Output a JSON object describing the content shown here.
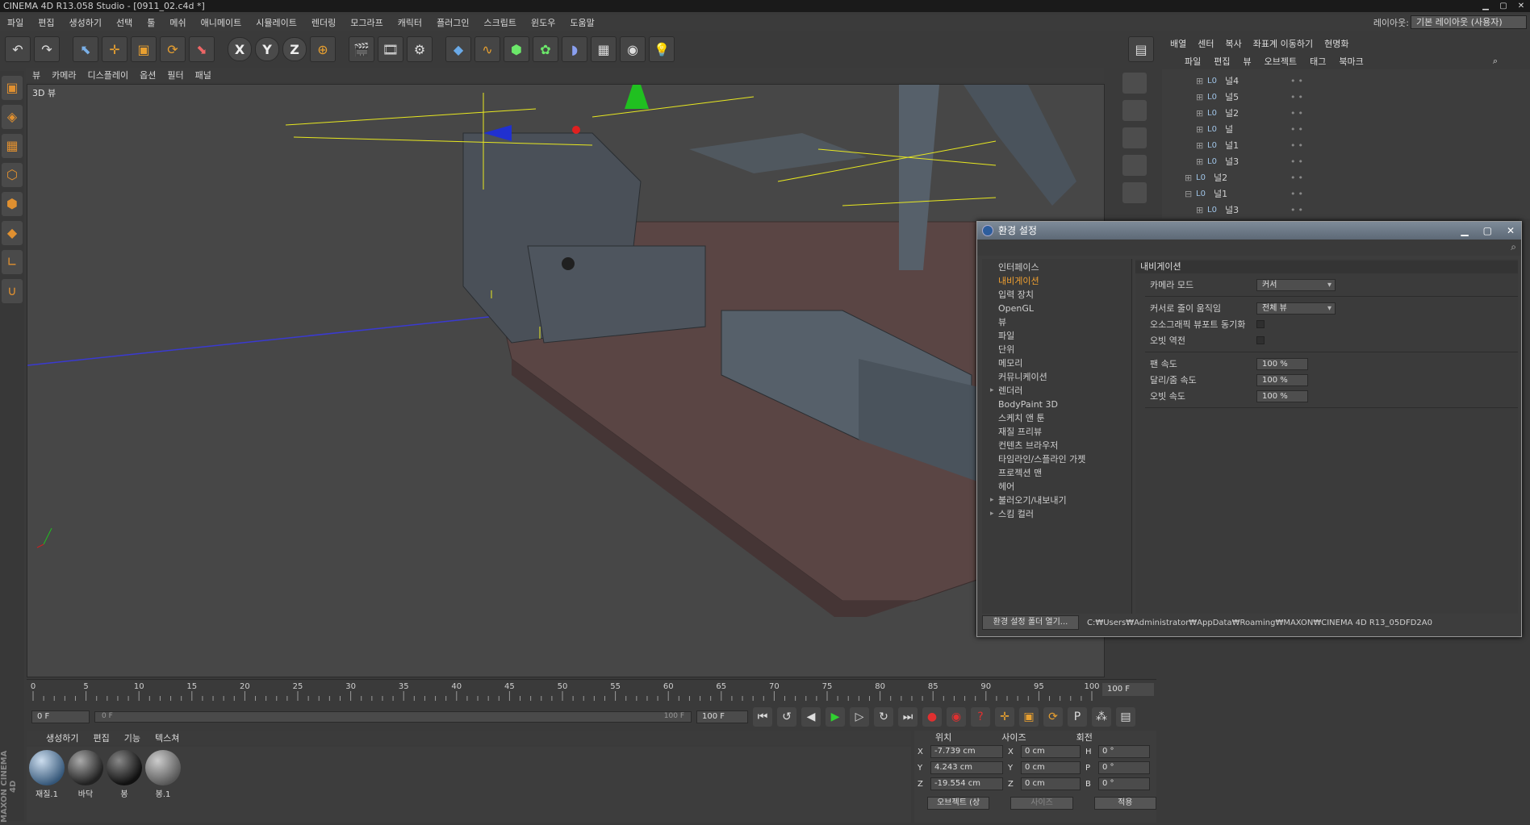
{
  "window": {
    "title": "CINEMA 4D R13.058 Studio - [0911_02.c4d *]"
  },
  "menubar": {
    "items": [
      "파일",
      "편집",
      "생성하기",
      "선택",
      "툴",
      "메쉬",
      "애니메이트",
      "시뮬레이트",
      "렌더링",
      "모그라프",
      "캐릭터",
      "플러그인",
      "스크립트",
      "윈도우",
      "도움말"
    ]
  },
  "layout": {
    "label": "레이아웃:",
    "value": "기본 레이아웃 (사용자)"
  },
  "right_toolbar": {
    "items": [
      "배열",
      "센터",
      "복사",
      "좌표계 이동하기",
      "현명화"
    ]
  },
  "viewport_menu": {
    "items": [
      "뷰",
      "카메라",
      "디스플레이",
      "옵션",
      "필터",
      "패널"
    ]
  },
  "viewport": {
    "label": "3D 뷰"
  },
  "object_manager": {
    "menu": [
      "파일",
      "편집",
      "뷰",
      "오브젝트",
      "태그",
      "북마크"
    ],
    "rows": [
      "널4",
      "널5",
      "널2",
      "널",
      "널1",
      "널3",
      "널2",
      "널1",
      "널3"
    ]
  },
  "dialog": {
    "title": "환경 설정",
    "categories": [
      "인터페이스",
      "내비게이션",
      "입력 장치",
      "OpenGL",
      "뷰",
      "파일",
      "단위",
      "메모리",
      "커뮤니케이션",
      "렌더러",
      "BodyPaint 3D",
      "스케치 앤 툰",
      "재질 프리뷰",
      "컨텐츠 브라우저",
      "타임라인/스플라인 가젯",
      "프로젝션 맨",
      "헤어",
      "불러오기/내보내기",
      "스킴 컬러"
    ],
    "active_category": "내비게이션",
    "pane_title": "내비게이션",
    "props": {
      "camera_mode": {
        "label": "카메라 모드",
        "value": "커서"
      },
      "cursor_pos": {
        "label": "커서로 줄이 움직임",
        "value": "전체 뷰"
      },
      "ortho_sync": {
        "label": "오소그래픽 뷰포트 동기화"
      },
      "orbit_reverse": {
        "label": "오빗 역전"
      },
      "pan_speed": {
        "label": "팬 속도",
        "value": "100 %"
      },
      "dolly_speed": {
        "label": "달리/줌 속도",
        "value": "100 %"
      },
      "orbit_speed": {
        "label": "오빗 속도",
        "value": "100 %"
      }
    },
    "foot_button": "환경 설정 폴더 열기...",
    "foot_path": "C:₩Users₩Administrator₩AppData₩Roaming₩MAXON₩CINEMA 4D R13_05DFD2A0"
  },
  "timeline": {
    "ticks": [
      "0",
      "5",
      "10",
      "15",
      "20",
      "25",
      "30",
      "35",
      "40",
      "45",
      "50",
      "55",
      "60",
      "65",
      "70",
      "75",
      "80",
      "85",
      "90",
      "95",
      "100"
    ],
    "end_frame": "100 F"
  },
  "transport": {
    "current": "0 F",
    "range_start": "0 F",
    "range_end": "100 F",
    "max": "100 F"
  },
  "material_manager": {
    "menu": [
      "생성하기",
      "편집",
      "기능",
      "텍스쳐"
    ],
    "materials": [
      "재질.1",
      "바닥",
      "봉",
      "봉.1"
    ]
  },
  "coordinates": {
    "headers": [
      "위치",
      "사이즈",
      "회전"
    ],
    "rows": [
      {
        "axis": "X",
        "pos": "-7.739 cm",
        "size_axis": "X",
        "size": "0 cm",
        "rot_axis": "H",
        "rot": "0 °"
      },
      {
        "axis": "Y",
        "pos": "4.243 cm",
        "size_axis": "Y",
        "size": "0 cm",
        "rot_axis": "P",
        "rot": "0 °"
      },
      {
        "axis": "Z",
        "pos": "-19.554 cm",
        "size_axis": "Z",
        "size": "0 cm",
        "rot_axis": "B",
        "rot": "0 °"
      }
    ],
    "mode": "오브젝트 (상",
    "size_mode": "사이즈",
    "apply": "적용"
  },
  "brand": "MAXON CINEMA 4D"
}
